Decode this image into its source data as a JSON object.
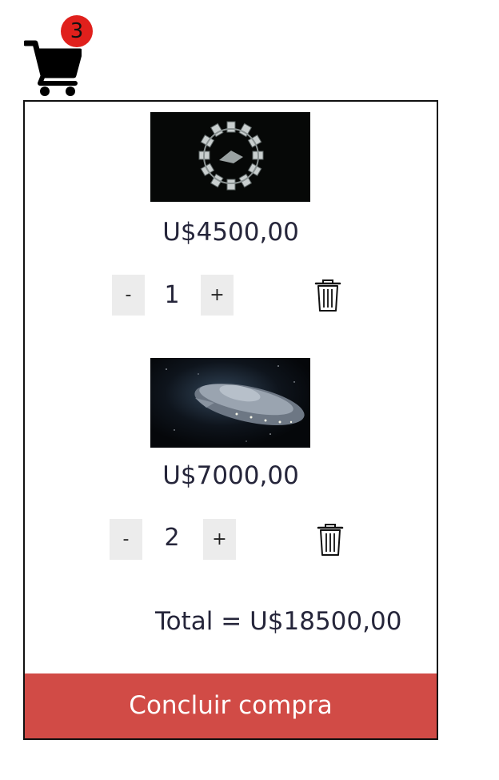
{
  "cart": {
    "item_count": "3",
    "items": [
      {
        "image": "interstellar-spacecraft-ring-image",
        "price": "U$4500,00",
        "quantity": "1",
        "decrement_label": "-",
        "increment_label": "+"
      },
      {
        "image": "flying-saucer-spaceship-image",
        "price": "U$7000,00",
        "quantity": "2",
        "decrement_label": "-",
        "increment_label": "+"
      }
    ],
    "total": "Total = U$18500,00",
    "checkout_label": "Concluir compra"
  },
  "icons": {
    "cart": "shopping-cart-icon",
    "delete": "trash-icon"
  },
  "colors": {
    "badge": "#e0201c",
    "checkout_button": "#d14b46",
    "stepper_button": "#ececec",
    "panel_border": "#111111"
  }
}
